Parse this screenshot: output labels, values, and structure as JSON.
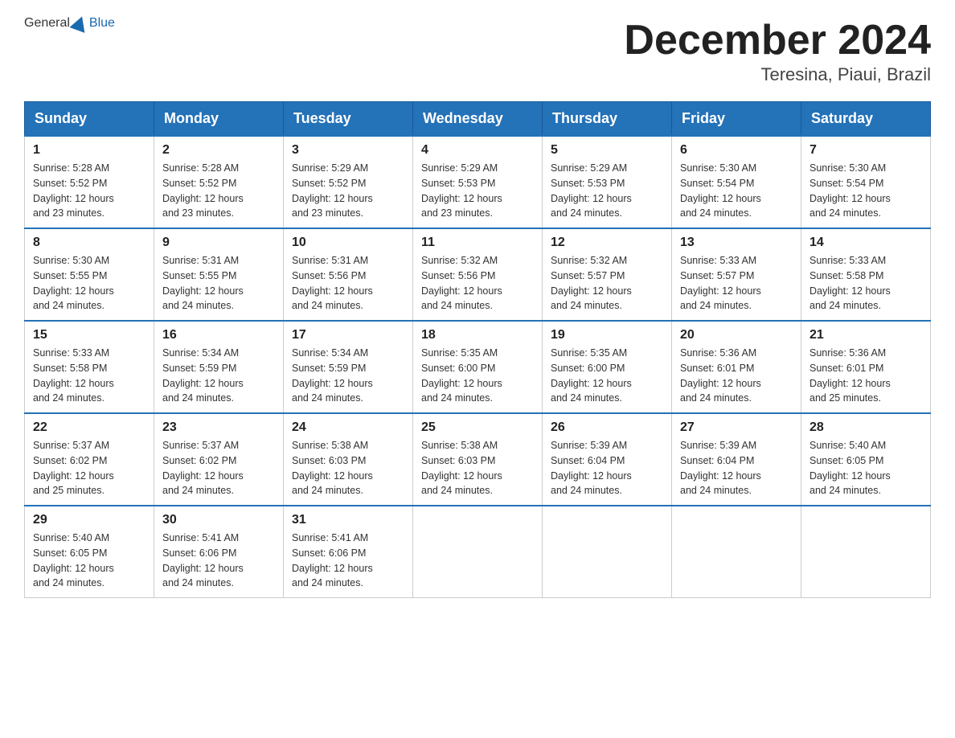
{
  "logo": {
    "general": "General",
    "blue": "Blue"
  },
  "title": "December 2024",
  "location": "Teresina, Piaui, Brazil",
  "days_of_week": [
    "Sunday",
    "Monday",
    "Tuesday",
    "Wednesday",
    "Thursday",
    "Friday",
    "Saturday"
  ],
  "weeks": [
    [
      {
        "day": "1",
        "sunrise": "5:28 AM",
        "sunset": "5:52 PM",
        "daylight": "12 hours and 23 minutes."
      },
      {
        "day": "2",
        "sunrise": "5:28 AM",
        "sunset": "5:52 PM",
        "daylight": "12 hours and 23 minutes."
      },
      {
        "day": "3",
        "sunrise": "5:29 AM",
        "sunset": "5:52 PM",
        "daylight": "12 hours and 23 minutes."
      },
      {
        "day": "4",
        "sunrise": "5:29 AM",
        "sunset": "5:53 PM",
        "daylight": "12 hours and 23 minutes."
      },
      {
        "day": "5",
        "sunrise": "5:29 AM",
        "sunset": "5:53 PM",
        "daylight": "12 hours and 24 minutes."
      },
      {
        "day": "6",
        "sunrise": "5:30 AM",
        "sunset": "5:54 PM",
        "daylight": "12 hours and 24 minutes."
      },
      {
        "day": "7",
        "sunrise": "5:30 AM",
        "sunset": "5:54 PM",
        "daylight": "12 hours and 24 minutes."
      }
    ],
    [
      {
        "day": "8",
        "sunrise": "5:30 AM",
        "sunset": "5:55 PM",
        "daylight": "12 hours and 24 minutes."
      },
      {
        "day": "9",
        "sunrise": "5:31 AM",
        "sunset": "5:55 PM",
        "daylight": "12 hours and 24 minutes."
      },
      {
        "day": "10",
        "sunrise": "5:31 AM",
        "sunset": "5:56 PM",
        "daylight": "12 hours and 24 minutes."
      },
      {
        "day": "11",
        "sunrise": "5:32 AM",
        "sunset": "5:56 PM",
        "daylight": "12 hours and 24 minutes."
      },
      {
        "day": "12",
        "sunrise": "5:32 AM",
        "sunset": "5:57 PM",
        "daylight": "12 hours and 24 minutes."
      },
      {
        "day": "13",
        "sunrise": "5:33 AM",
        "sunset": "5:57 PM",
        "daylight": "12 hours and 24 minutes."
      },
      {
        "day": "14",
        "sunrise": "5:33 AM",
        "sunset": "5:58 PM",
        "daylight": "12 hours and 24 minutes."
      }
    ],
    [
      {
        "day": "15",
        "sunrise": "5:33 AM",
        "sunset": "5:58 PM",
        "daylight": "12 hours and 24 minutes."
      },
      {
        "day": "16",
        "sunrise": "5:34 AM",
        "sunset": "5:59 PM",
        "daylight": "12 hours and 24 minutes."
      },
      {
        "day": "17",
        "sunrise": "5:34 AM",
        "sunset": "5:59 PM",
        "daylight": "12 hours and 24 minutes."
      },
      {
        "day": "18",
        "sunrise": "5:35 AM",
        "sunset": "6:00 PM",
        "daylight": "12 hours and 24 minutes."
      },
      {
        "day": "19",
        "sunrise": "5:35 AM",
        "sunset": "6:00 PM",
        "daylight": "12 hours and 24 minutes."
      },
      {
        "day": "20",
        "sunrise": "5:36 AM",
        "sunset": "6:01 PM",
        "daylight": "12 hours and 24 minutes."
      },
      {
        "day": "21",
        "sunrise": "5:36 AM",
        "sunset": "6:01 PM",
        "daylight": "12 hours and 25 minutes."
      }
    ],
    [
      {
        "day": "22",
        "sunrise": "5:37 AM",
        "sunset": "6:02 PM",
        "daylight": "12 hours and 25 minutes."
      },
      {
        "day": "23",
        "sunrise": "5:37 AM",
        "sunset": "6:02 PM",
        "daylight": "12 hours and 24 minutes."
      },
      {
        "day": "24",
        "sunrise": "5:38 AM",
        "sunset": "6:03 PM",
        "daylight": "12 hours and 24 minutes."
      },
      {
        "day": "25",
        "sunrise": "5:38 AM",
        "sunset": "6:03 PM",
        "daylight": "12 hours and 24 minutes."
      },
      {
        "day": "26",
        "sunrise": "5:39 AM",
        "sunset": "6:04 PM",
        "daylight": "12 hours and 24 minutes."
      },
      {
        "day": "27",
        "sunrise": "5:39 AM",
        "sunset": "6:04 PM",
        "daylight": "12 hours and 24 minutes."
      },
      {
        "day": "28",
        "sunrise": "5:40 AM",
        "sunset": "6:05 PM",
        "daylight": "12 hours and 24 minutes."
      }
    ],
    [
      {
        "day": "29",
        "sunrise": "5:40 AM",
        "sunset": "6:05 PM",
        "daylight": "12 hours and 24 minutes."
      },
      {
        "day": "30",
        "sunrise": "5:41 AM",
        "sunset": "6:06 PM",
        "daylight": "12 hours and 24 minutes."
      },
      {
        "day": "31",
        "sunrise": "5:41 AM",
        "sunset": "6:06 PM",
        "daylight": "12 hours and 24 minutes."
      },
      null,
      null,
      null,
      null
    ]
  ],
  "labels": {
    "sunrise": "Sunrise:",
    "sunset": "Sunset:",
    "daylight": "Daylight:"
  }
}
